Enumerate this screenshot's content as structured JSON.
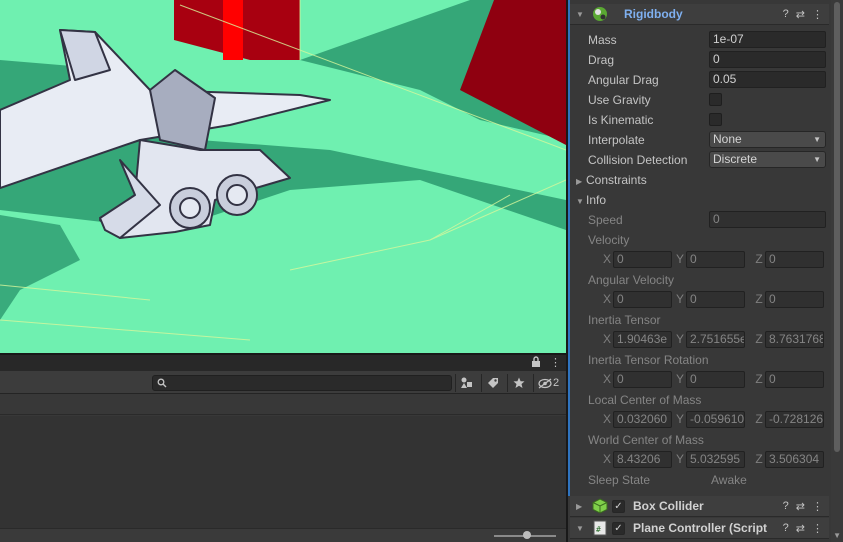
{
  "inspector": {
    "rigidbody": {
      "title": "Rigidbody",
      "mass_label": "Mass",
      "mass_value": "1e-07",
      "drag_label": "Drag",
      "drag_value": "0",
      "angular_drag_label": "Angular Drag",
      "angular_drag_value": "0.05",
      "use_gravity_label": "Use Gravity",
      "use_gravity_checked": false,
      "is_kinematic_label": "Is Kinematic",
      "is_kinematic_checked": false,
      "interpolate_label": "Interpolate",
      "interpolate_value": "None",
      "collision_detection_label": "Collision Detection",
      "collision_detection_value": "Discrete",
      "constraints_label": "Constraints",
      "info_label": "Info",
      "info": {
        "speed_label": "Speed",
        "speed_value": "0",
        "velocity_label": "Velocity",
        "velocity": {
          "x": "0",
          "y": "0",
          "z": "0"
        },
        "angular_velocity_label": "Angular Velocity",
        "angular_velocity": {
          "x": "0",
          "y": "0",
          "z": "0"
        },
        "inertia_tensor_label": "Inertia Tensor",
        "inertia_tensor": {
          "x": "1.90463e",
          "y": "2.751655e",
          "z": "8.7631768"
        },
        "inertia_tensor_rotation_label": "Inertia Tensor Rotation",
        "inertia_tensor_rotation": {
          "x": "0",
          "y": "0",
          "z": "0"
        },
        "local_center_of_mass_label": "Local Center of Mass",
        "local_center_of_mass": {
          "x": "0.032060",
          "y": "-0.059610",
          "z": "-0.728126"
        },
        "world_center_of_mass_label": "World Center of Mass",
        "world_center_of_mass": {
          "x": "8.43206",
          "y": "5.032595",
          "z": "3.506304"
        },
        "sleep_state_label": "Sleep State",
        "sleep_state_value": "Awake"
      },
      "axis_labels": {
        "x": "X",
        "y": "Y",
        "z": "Z"
      }
    },
    "box_collider": {
      "title": "Box Collider",
      "enabled": true
    },
    "plane_controller": {
      "title": "Plane Controller (Script",
      "enabled": true
    }
  },
  "icons": {
    "help": "?",
    "settings": "⇄",
    "more": "⋮",
    "lock": "🔒",
    "check": "✓"
  },
  "bottom_panel": {
    "search_placeholder": "",
    "search_value": "",
    "hidden_count": "2"
  },
  "colors": {
    "scene_ground": "#6ff0b0",
    "selection_accent": "#2f74c0",
    "rigidbody_title": "#7fb0f0",
    "red_object": "#b00010"
  }
}
